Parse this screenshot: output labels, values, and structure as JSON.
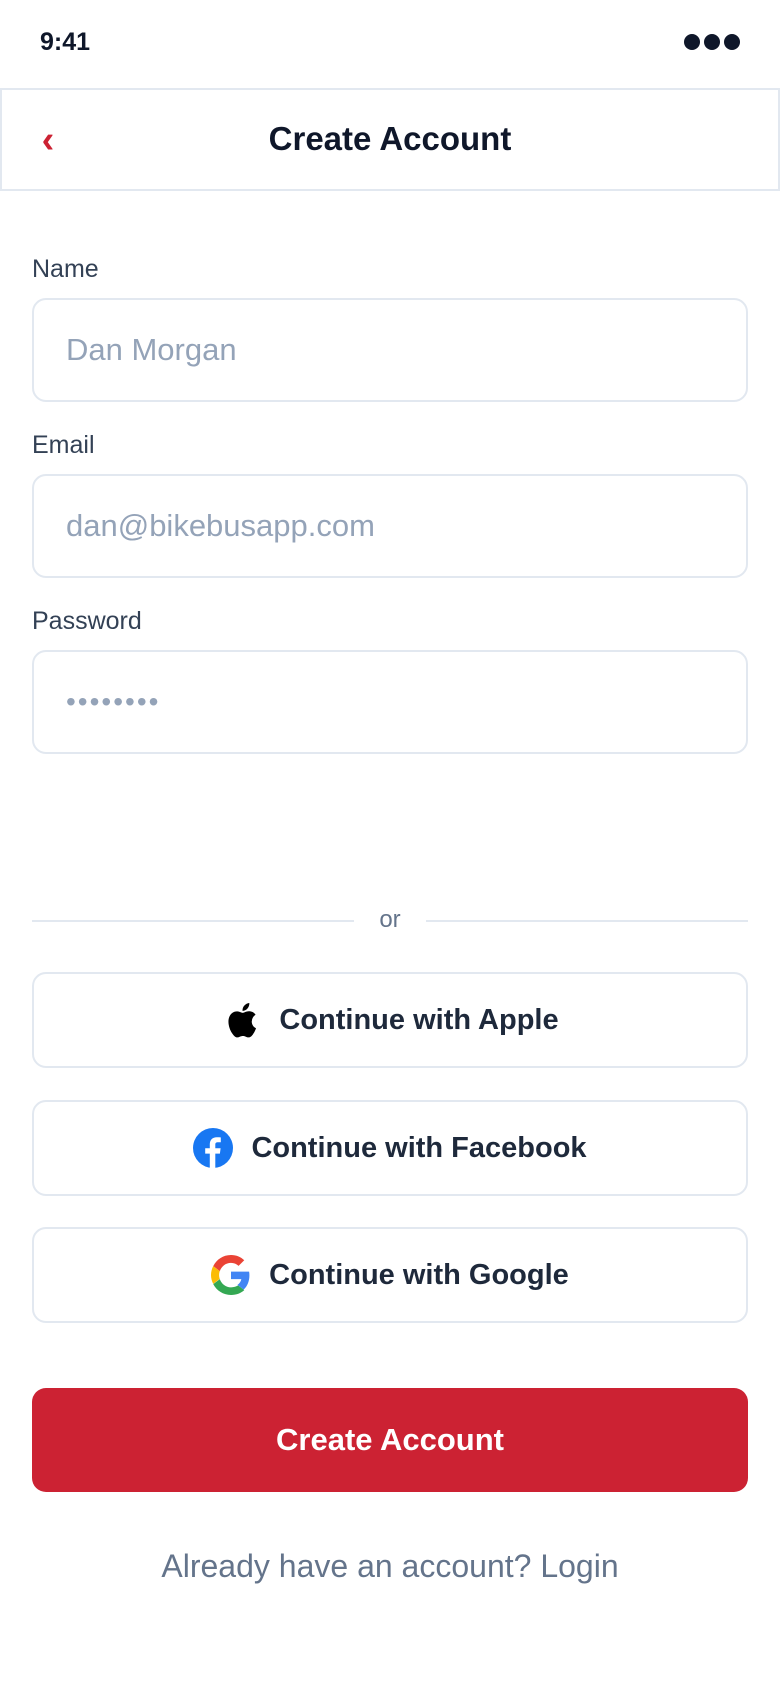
{
  "status_bar": {
    "time": "9:41"
  },
  "header": {
    "title": "Create Account",
    "back_icon": "chevron-left-icon"
  },
  "form": {
    "name": {
      "label": "Name",
      "placeholder": "Dan Morgan"
    },
    "email": {
      "label": "Email",
      "placeholder": "dan@bikebusapp.com"
    },
    "password": {
      "label": "Password",
      "masked_value": "••••••••"
    }
  },
  "divider": {
    "text": "or"
  },
  "social": {
    "apple": {
      "label": "Continue with Apple",
      "icon": "apple-icon"
    },
    "facebook": {
      "label": "Continue with Facebook",
      "icon": "facebook-icon"
    },
    "google": {
      "label": "Continue with Google",
      "icon": "google-icon"
    }
  },
  "primary_button": {
    "label": "Create Account"
  },
  "footer": {
    "text": "Already have an account? Login"
  },
  "colors": {
    "accent": "#cc2233",
    "border": "#e2e8f0",
    "text": "#0f172a",
    "muted": "#64748b"
  }
}
